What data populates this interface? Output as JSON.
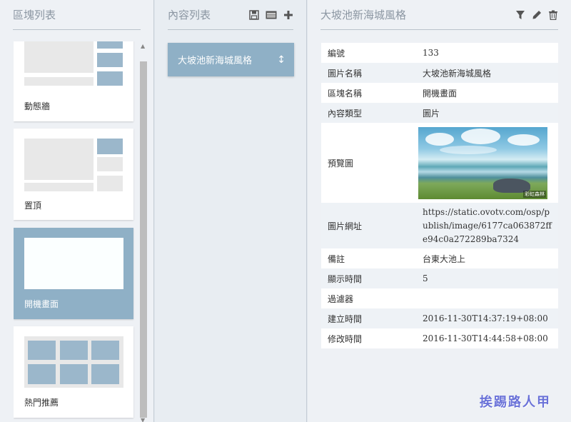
{
  "blocks_panel": {
    "title": "區塊列表",
    "items": [
      {
        "label": "動態牆"
      },
      {
        "label": "置頂"
      },
      {
        "label": "開機畫面",
        "selected": true
      },
      {
        "label": "熱門推薦"
      }
    ]
  },
  "content_panel": {
    "title": "內容列表",
    "icons": [
      "save-icon",
      "list-icon",
      "plus-icon"
    ],
    "items": [
      {
        "label": "大坡池新海城風格"
      }
    ]
  },
  "detail_panel": {
    "title": "大坡池新海城風格",
    "icons": [
      "filter-icon",
      "pencil-icon",
      "trash-icon"
    ],
    "rows": {
      "id": {
        "key": "編號",
        "value": "133"
      },
      "image_name": {
        "key": "圖片名稱",
        "value": "大坡池新海城風格"
      },
      "block_name": {
        "key": "區塊名稱",
        "value": "開機畫面"
      },
      "content_type": {
        "key": "內容類型",
        "value": "圖片"
      },
      "preview": {
        "key": "預覽圖",
        "caption": "彩虹森林"
      },
      "image_url": {
        "key": "圖片網址",
        "value": "https://static.ovotv.com/osp/publish/image/6177ca063872ffe94c0a272289ba7324"
      },
      "note": {
        "key": "備註",
        "value": "台東大池上"
      },
      "display_time": {
        "key": "顯示時間",
        "value": "5"
      },
      "filter": {
        "key": "過濾器",
        "value": ""
      },
      "created": {
        "key": "建立時間",
        "value": "2016-11-30T14:37:19+08:00"
      },
      "modified": {
        "key": "修改時間",
        "value": "2016-11-30T14:44:58+08:00"
      }
    }
  },
  "watermark": "挨踢路人甲",
  "colors": {
    "accent": "#8fb0c6",
    "tile": "#9bb7cb",
    "watermark": "#6a72d8"
  }
}
